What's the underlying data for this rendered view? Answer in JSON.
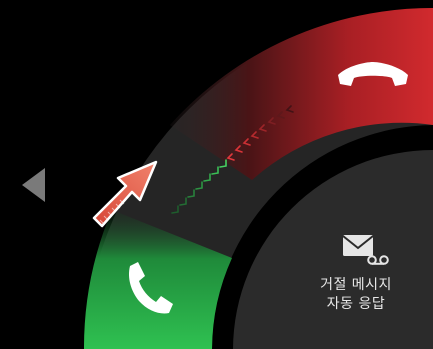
{
  "incoming_call": {
    "reject_message": {
      "line1": "거절 메시지",
      "line2": "자동 응답"
    },
    "answer_icon": "phone-handset-icon",
    "decline_icon": "phone-hangup-icon",
    "message_icon": "envelope-voicemail-icon",
    "left_arrow_icon": "chevron-left-icon",
    "hint_arrow_icon": "diagonal-arrow-icon"
  },
  "colors": {
    "answer": "#2db84d",
    "decline": "#c8282c",
    "ring_dark": "#2a2a2a",
    "panel": "#2b2b2b",
    "hint_arrow": "#e8604c"
  }
}
